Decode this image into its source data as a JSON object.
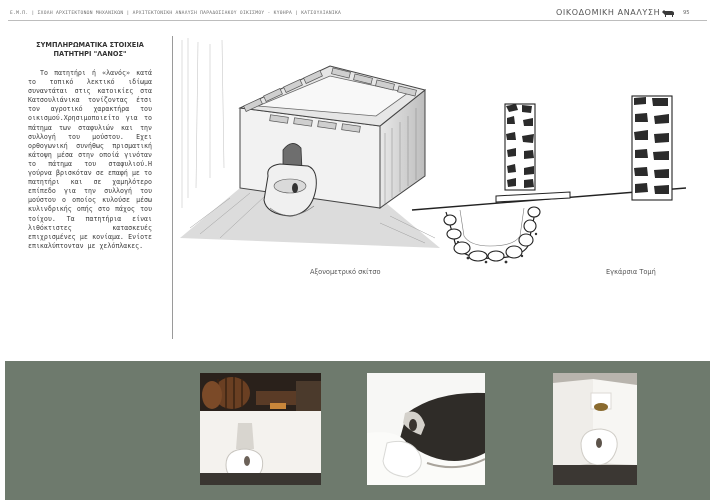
{
  "header": {
    "breadcrumb": "Ε.Μ.Π. | ΣΧΟΛΗ ΑΡΧΙΤΕΚΤΟΝΩΝ ΜΗΧΑΝΙΚΩΝ | ΑΡΧΙΤΕΚΤΟΝΙΚΗ ΑΝΑΛΥΣΗ ΠΑΡΑΔΟΣΙΑΚΟΥ ΟΙΚΙΣΜΟΥ - ΚΥΘΗΡΑ | ΚΑΤΣΟΥΛΙΑΝΙΚΑ",
    "section_title": "ΟΙΚΟΔΟΜΙΚΗ ΑΝΑΛΥΣΗ",
    "page_number": "95",
    "icon": "donkey-icon"
  },
  "text": {
    "heading_line1": "ΣΥΜΠΛΗΡΩΜΑΤΙΚΑ ΣΤΟΙΧΕΙΑ",
    "heading_line2": "ΠΑΤΗΤΗΡΙ \"ΛΑΝΟΣ\"",
    "body": "Το πατητήρι ή «λανός» κατά το τοπικό λεκτικό ιδίωμα συναντάται στις κατοικίες στα Κατσουλιάνικα τονίζοντας έτσι τον αγροτικό χαρακτήρα του οικισμού.Χρησιμοποιείτο για το πάτημα των σταφυλιών και την συλλογή του μούστου. Εχει ορθογωνική συνήθως πρισματική κάτοψη μέσα στην οποίά γινόταν το πάτημα του σταφυλιού.Η γούρνα βρισκόταν σε επαφή με το πατητήρι και σε χαμηλότερο επίπεδο για την συλλογή του μούστου ο οποίος κυλούσε μέσω κυλινδρικής οπής στο πάχος του τοίχου. Τα πατητήρια είναι λιθόκτιστες κατασκευές επιχρισμένες με κονίαμα. Ενίοτε επικαλύπτονταν με χελόπλακες."
  },
  "figures": {
    "axonometric_caption": "Αξονομετρικό σκίτσο",
    "section_caption": "Εγκάρσια Τομή"
  },
  "colors": {
    "photo_band": "#6e7a6d",
    "rule": "#bdbdbd"
  }
}
